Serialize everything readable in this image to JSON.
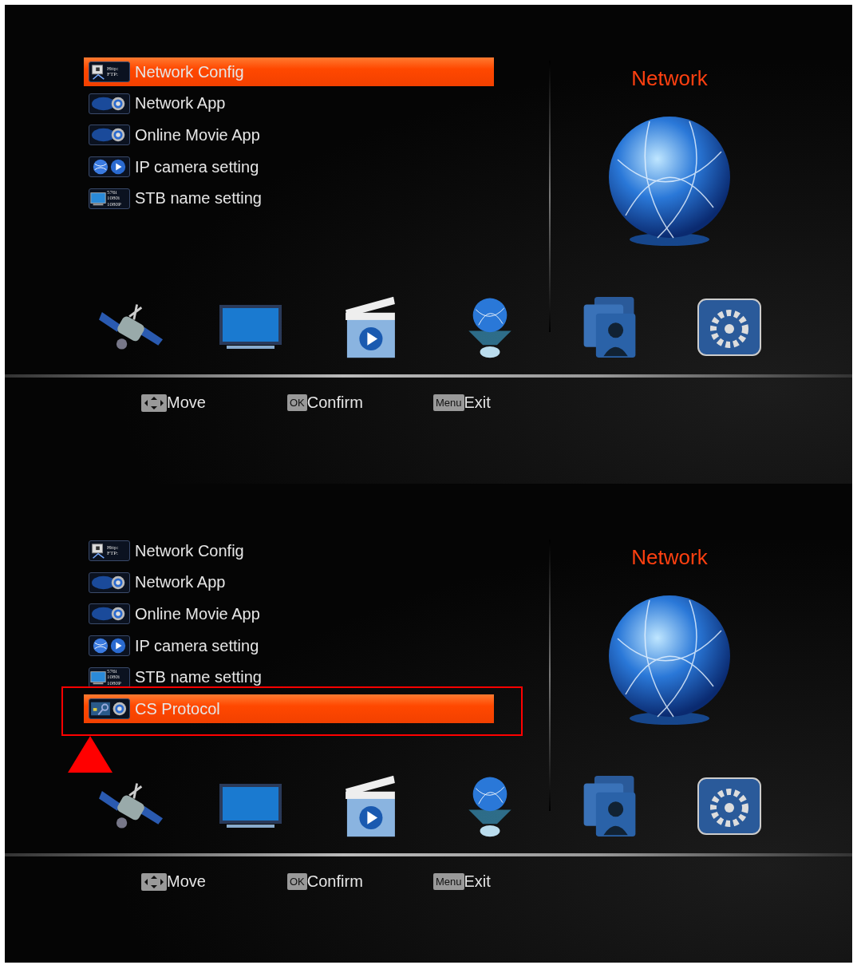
{
  "screens": [
    {
      "menu": [
        {
          "label": "Network Config",
          "kind": "http",
          "icon_text": [
            "Http:",
            "FTP:"
          ],
          "selected": true,
          "annotated": false
        },
        {
          "label": "Network App",
          "kind": "app",
          "selected": false,
          "annotated": false
        },
        {
          "label": "Online Movie App",
          "kind": "app",
          "selected": false,
          "annotated": false
        },
        {
          "label": "IP camera setting",
          "kind": "camera",
          "selected": false,
          "annotated": false
        },
        {
          "label": "STB name setting",
          "kind": "stb",
          "icon_text": [
            "576i",
            "1080i",
            "1080P"
          ],
          "selected": false,
          "annotated": false
        }
      ],
      "panel_title": "Network",
      "categories": [
        {
          "kind": "satellite"
        },
        {
          "kind": "tv"
        },
        {
          "kind": "movie"
        },
        {
          "kind": "network"
        },
        {
          "kind": "people"
        },
        {
          "kind": "settings"
        }
      ],
      "hints": [
        {
          "kind": "arrows",
          "label": "Move"
        },
        {
          "kind": "key",
          "key": "OK",
          "label": "Confirm"
        },
        {
          "kind": "key",
          "key": "Menu",
          "label": "Exit"
        }
      ]
    },
    {
      "menu": [
        {
          "label": "Network Config",
          "kind": "http",
          "icon_text": [
            "Http:",
            "FTP:"
          ],
          "selected": false,
          "annotated": false
        },
        {
          "label": "Network App",
          "kind": "app",
          "selected": false,
          "annotated": false
        },
        {
          "label": "Online Movie App",
          "kind": "app",
          "selected": false,
          "annotated": false
        },
        {
          "label": "IP camera setting",
          "kind": "camera",
          "selected": false,
          "annotated": false
        },
        {
          "label": "STB name setting",
          "kind": "stb",
          "icon_text": [
            "576i",
            "1080i",
            "1080P"
          ],
          "selected": false,
          "annotated": false
        },
        {
          "label": "CS Protocol",
          "kind": "key",
          "selected": true,
          "annotated": true
        }
      ],
      "panel_title": "Network",
      "categories": [
        {
          "kind": "satellite"
        },
        {
          "kind": "tv"
        },
        {
          "kind": "movie"
        },
        {
          "kind": "network"
        },
        {
          "kind": "people"
        },
        {
          "kind": "settings"
        }
      ],
      "hints": [
        {
          "kind": "arrows",
          "label": "Move"
        },
        {
          "kind": "key",
          "key": "OK",
          "label": "Confirm"
        },
        {
          "kind": "key",
          "key": "Menu",
          "label": "Exit"
        }
      ]
    }
  ]
}
